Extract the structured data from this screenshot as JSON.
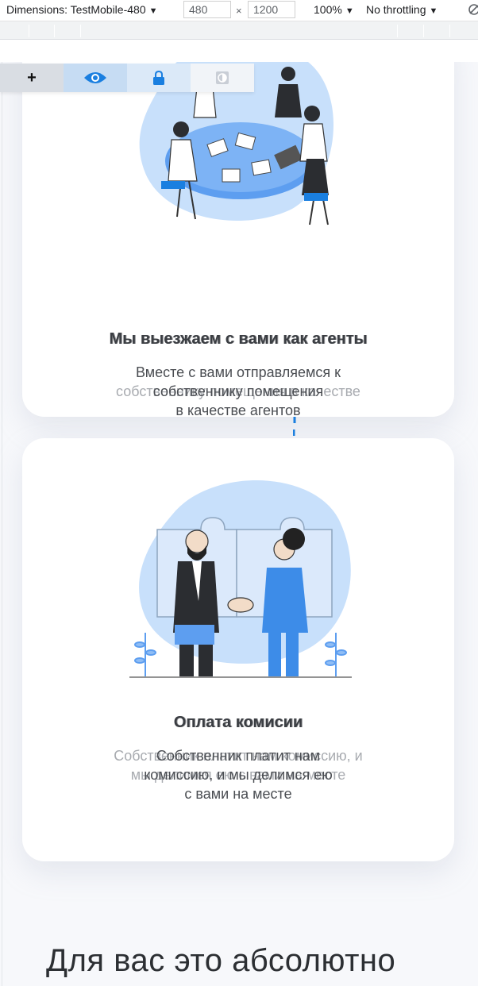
{
  "devtools": {
    "dimensions_label": "Dimensions: TestMobile-480",
    "width_value": "480",
    "height_value": "1200",
    "times": "×",
    "zoom": "100%",
    "throttling": "No throttling",
    "caret": "▼"
  },
  "toolbar": {
    "plus_label": "+",
    "accent_color": "#1a7fe0"
  },
  "cards": [
    {
      "title": "Мы выезжаем с вами как агенты",
      "description_line1": "Вместе с вами отправляемся к",
      "description_line2": "собственнику помещения",
      "description_line3": "в качестве агентов",
      "ghost_line": "собственнику помещения в качестве",
      "illustration": "people-meeting-at-table"
    },
    {
      "title": "Оплата комисии",
      "description_line1": "Собственник платит нам",
      "description_line2": "комиссию, и мы делимся ею",
      "description_line3": "с вами на месте",
      "ghost_line1": "Собственник платит нам комиссию, и",
      "ghost_line2": "мы делимся ею с вами на месте",
      "illustration": "handshake-puzzle"
    }
  ],
  "bottom_heading": "Для вас это абсолютно",
  "colors": {
    "blob": "#c8e0fb",
    "blob_dark": "#5d9ef0",
    "connector": "#1a7fe0"
  }
}
